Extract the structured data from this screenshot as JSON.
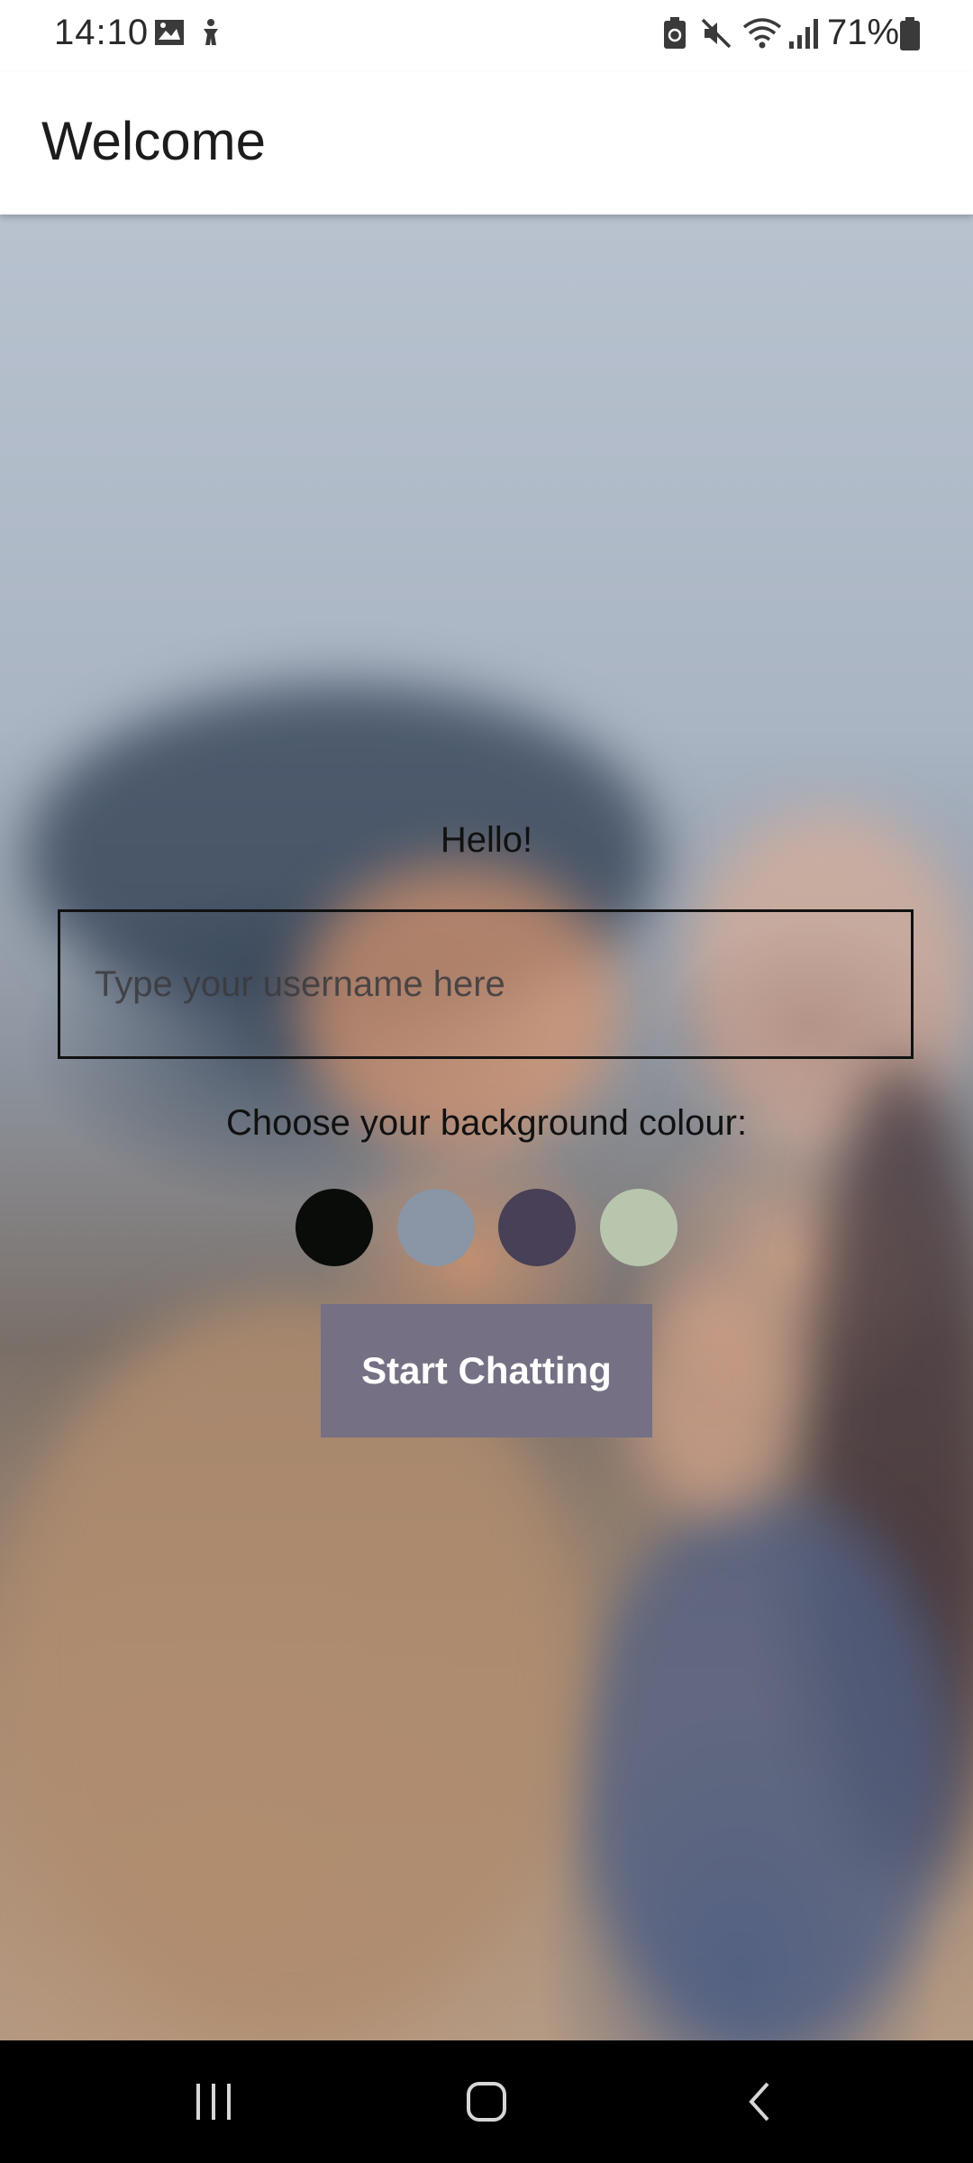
{
  "status_bar": {
    "time": "14:10",
    "battery_percent": "71%",
    "icons": [
      "gallery-icon",
      "accessibility-icon",
      "battery-saver-icon",
      "mute-icon",
      "wifi-icon",
      "signal-icon",
      "battery-icon"
    ]
  },
  "app_bar": {
    "title": "Welcome"
  },
  "form": {
    "greeting": "Hello!",
    "username_placeholder": "Type your username here",
    "username_value": "",
    "color_prompt": "Choose your background colour:",
    "color_options": [
      "#090C08",
      "#8A95A5",
      "#474056",
      "#B9C6AE"
    ],
    "start_button_label": "Start Chatting",
    "start_button_color": "#757083"
  },
  "nav_bar": {
    "buttons": [
      "recent-apps-icon",
      "home-icon",
      "back-icon"
    ]
  }
}
